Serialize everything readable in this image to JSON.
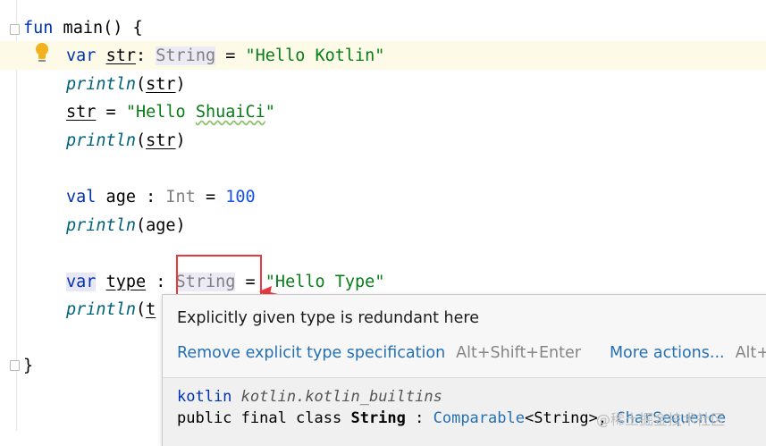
{
  "editor": {
    "fold_markers": [
      "fold-open",
      "fold-close"
    ],
    "lines": [
      {
        "id": "l1",
        "parts": [
          [
            "kw",
            "fun"
          ],
          [
            "plain",
            " main() {"
          ]
        ]
      },
      {
        "id": "l2",
        "parts": [
          [
            "kw",
            "var"
          ],
          [
            "plain",
            " "
          ],
          [
            "ulvar",
            "str"
          ],
          [
            "plain",
            ": "
          ],
          [
            "tybg",
            "String"
          ],
          [
            "plain",
            " = "
          ],
          [
            "str",
            "\"Hello Kotlin\""
          ]
        ]
      },
      {
        "id": "l3",
        "parts": [
          [
            "it",
            "println"
          ],
          [
            "plain",
            "("
          ],
          [
            "ul",
            "str"
          ],
          [
            "plain",
            ")"
          ]
        ]
      },
      {
        "id": "l4",
        "parts": [
          [
            "ul",
            "str"
          ],
          [
            "plain",
            " = "
          ],
          [
            "str",
            "\"Hello "
          ],
          [
            "strwavy",
            "ShuaiCi"
          ],
          [
            "str",
            "\""
          ]
        ]
      },
      {
        "id": "l5",
        "parts": [
          [
            "it",
            "println"
          ],
          [
            "plain",
            "("
          ],
          [
            "ul",
            "str"
          ],
          [
            "plain",
            ")"
          ]
        ]
      },
      {
        "id": "l6",
        "parts": [
          [
            "kw",
            "val"
          ],
          [
            "plain",
            " age : "
          ],
          [
            "ty",
            "Int"
          ],
          [
            "plain",
            " = "
          ],
          [
            "num",
            "100"
          ]
        ]
      },
      {
        "id": "l7",
        "parts": [
          [
            "it",
            "println"
          ],
          [
            "plain",
            "(age)"
          ]
        ]
      },
      {
        "id": "l8",
        "parts": [
          [
            "kwbg",
            "var"
          ],
          [
            "plain",
            " "
          ],
          [
            "ul",
            "type"
          ],
          [
            "plain",
            " : "
          ],
          [
            "tybg",
            "String"
          ],
          [
            "plain",
            " = "
          ],
          [
            "str",
            "\"Hello Type\""
          ]
        ]
      },
      {
        "id": "l9",
        "parts": [
          [
            "it",
            "println"
          ],
          [
            "plain",
            "("
          ],
          [
            "ul",
            "t"
          ]
        ]
      },
      {
        "id": "l10",
        "parts": [
          [
            "plain",
            "}"
          ]
        ]
      }
    ]
  },
  "popup": {
    "message": "Explicitly given type is redundant here",
    "action_primary": "Remove explicit type specification",
    "action_primary_shortcut": "Alt+Shift+Enter",
    "action_more": "More actions...",
    "action_more_shortcut": "Alt+I",
    "doc_keyword": "kotlin",
    "doc_package": "kotlin.kotlin_builtins",
    "doc_prefix": "public final class ",
    "doc_class": "String",
    "doc_sep": " : ",
    "doc_super1": "Comparable",
    "doc_generic": "<String>, ",
    "doc_super2": "CharSequence"
  },
  "watermark": "@稀土掘金技术社区",
  "colors": {
    "keyword": "#0033b3",
    "string": "#067d17",
    "number": "#1750eb",
    "highlight_box": "#e8383d",
    "link": "#2470b3"
  }
}
